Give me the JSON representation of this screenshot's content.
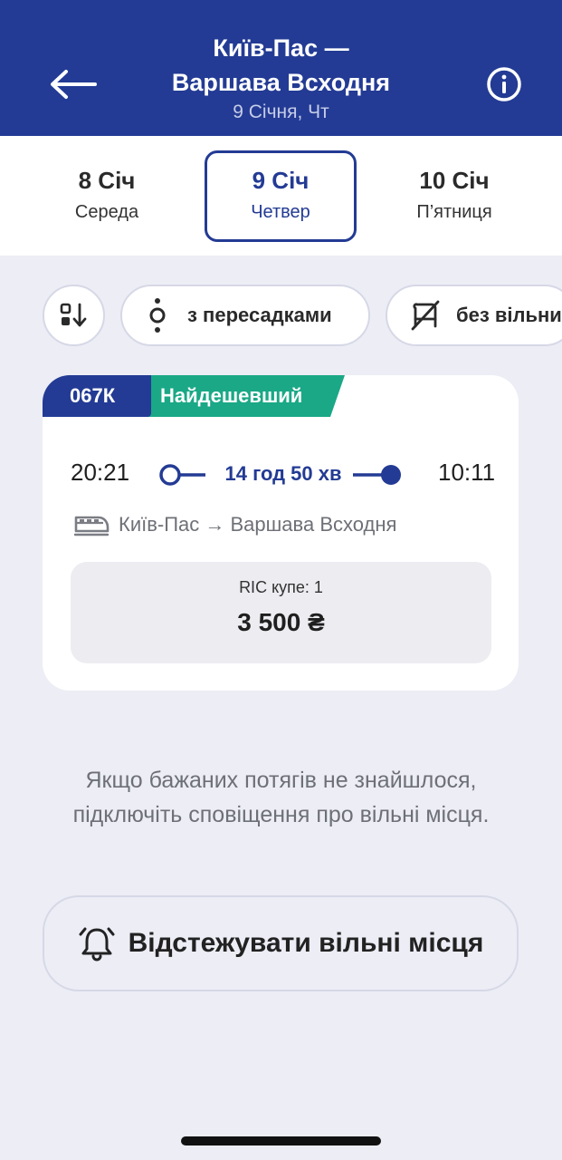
{
  "header": {
    "title_line1": "Київ-Пас —",
    "title_line2": "Варшава Всходня",
    "subtitle": "9 Січня, Чт",
    "back_icon": "arrow-left-icon",
    "info_icon": "info-icon"
  },
  "dates": [
    {
      "day": "8 Січ",
      "weekday": "Середа",
      "active": false
    },
    {
      "day": "9 Січ",
      "weekday": "Четвер",
      "active": true
    },
    {
      "day": "10 Січ",
      "weekday": "П’ятниця",
      "active": false
    }
  ],
  "filters": {
    "sort_icon": "sort-icon",
    "transfers_label": "з пересадками",
    "transfers_icon": "transfer-icon",
    "no_seats_label": "без вільних",
    "no_seats_icon": "no-seats-icon"
  },
  "train": {
    "number": "067К",
    "badge": "Найдешевший",
    "departure": "20:21",
    "arrival": "10:11",
    "duration": "14 год 50 хв",
    "stations": "Київ-Пас → Варшава Всходня",
    "train_icon": "train-icon",
    "class_label": "RIC купе: 1",
    "price": "3 500 ₴"
  },
  "hint": "Якщо бажаних потягів не знайшлося, підключіть сповіщення про вільні місця.",
  "track_button": {
    "label": "Відстежувати вільні місця",
    "icon": "bell-icon"
  },
  "colors": {
    "primary": "#233b94",
    "accent_green": "#1aa886",
    "background": "#ecedf5"
  }
}
